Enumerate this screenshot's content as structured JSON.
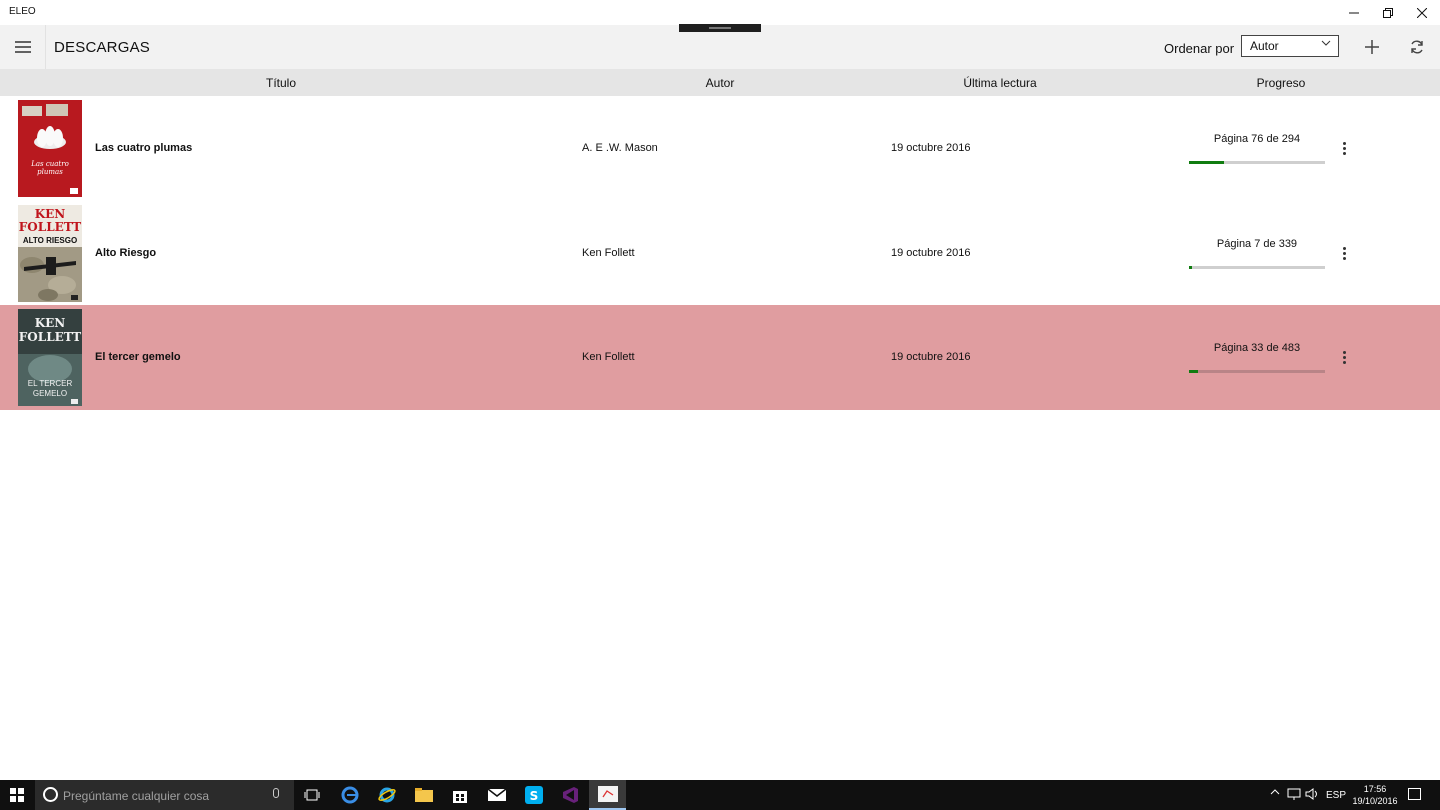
{
  "window": {
    "app_title": "ELEO"
  },
  "header": {
    "page_title": "DESCARGAS",
    "sort_label": "Ordenar por",
    "sort_value": "Autor"
  },
  "columns": {
    "title": "Título",
    "author": "Autor",
    "last_read": "Última lectura",
    "progress": "Progreso"
  },
  "books": [
    {
      "title": "Las cuatro plumas",
      "author": "A. E .W. Mason",
      "last_read": "19 octubre 2016",
      "page_text": "Página 76 de 294",
      "progress": 0.2585,
      "cover_lines": [
        "Las cuatro plumas"
      ]
    },
    {
      "title": "Alto Riesgo",
      "author": "Ken Follett",
      "last_read": "19 octubre 2016",
      "page_text": "Página 7 de 339",
      "progress": 0.0206,
      "cover_lines": [
        "KEN",
        "FOLLETT",
        "ALTO RIESGO"
      ]
    },
    {
      "title": "El tercer gemelo",
      "author": "Ken Follett",
      "last_read": "19 octubre 2016",
      "page_text": "Página 33 de 483",
      "progress": 0.0683,
      "cover_lines": [
        "KEN",
        "FOLLETT",
        "EL TERCER",
        "GEMELO"
      ]
    }
  ],
  "selected_row_color": "#e09da0",
  "progress_color": "#107c10",
  "taskbar": {
    "search_placeholder": "Pregúntame cualquier cosa",
    "language": "ESP",
    "time": "17:56",
    "date": "19/10/2016"
  }
}
